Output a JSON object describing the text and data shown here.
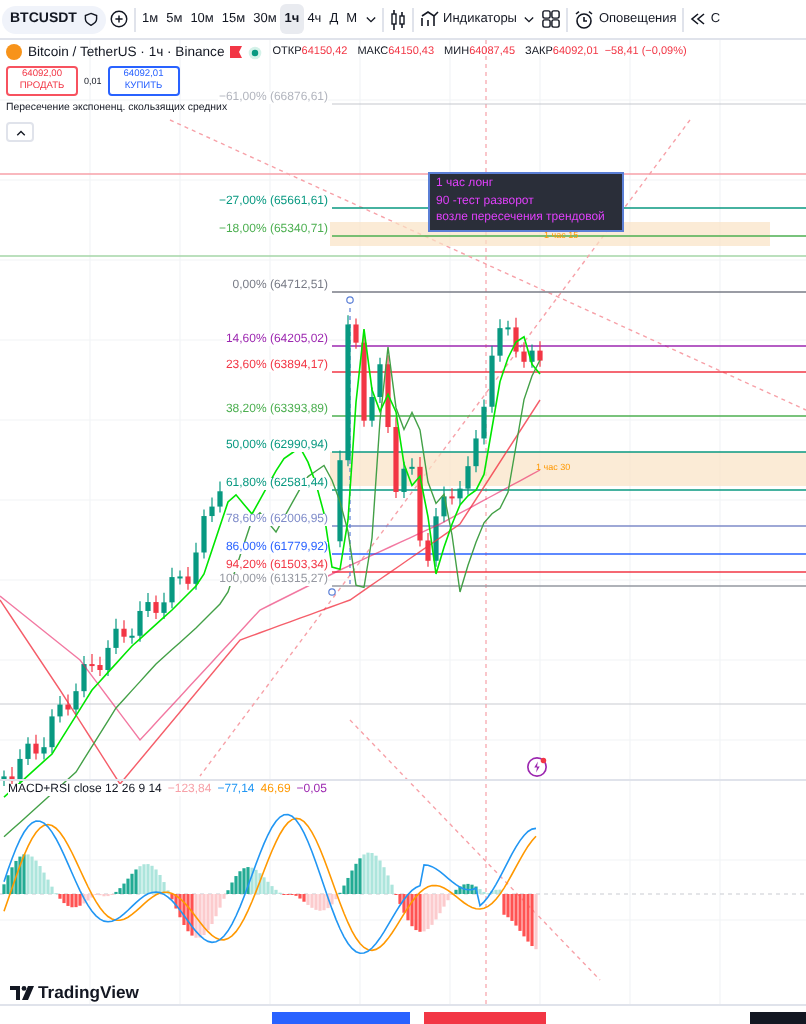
{
  "toolbar": {
    "symbol": "BTCUSDT",
    "intervals": [
      {
        "label": "1м",
        "selected": false
      },
      {
        "label": "5м",
        "selected": false
      },
      {
        "label": "10м",
        "selected": false
      },
      {
        "label": "15м",
        "selected": false
      },
      {
        "label": "30м",
        "selected": false
      },
      {
        "label": "1ч",
        "selected": true
      },
      {
        "label": "4ч",
        "selected": false
      },
      {
        "label": "Д",
        "selected": false
      },
      {
        "label": "М",
        "selected": false
      }
    ],
    "indicators_button": "Индикаторы",
    "alerts_button": "Оповещения",
    "replay_button": "С"
  },
  "legend": {
    "title": "Bitcoin / TetherUS · 1ч · Binance",
    "ohlc": [
      {
        "key": "ОТКР",
        "value": "64150,42"
      },
      {
        "key": "МАКС",
        "value": "64150,43"
      },
      {
        "key": "МИН",
        "value": "64087,45"
      },
      {
        "key": "ЗАКР",
        "value": "64092,01"
      }
    ],
    "change": "−58,41 (−0,09%)"
  },
  "trade": {
    "sell_price": "64092,00",
    "sell_label": "ПРОДАТЬ",
    "spread": "0,01",
    "buy_price": "64092,01",
    "buy_label": "КУПИТЬ"
  },
  "indicator_legend": "Пересечение экспоненц. скользящих средних",
  "fib_levels": [
    {
      "label": "−61,00% (66876,61)",
      "color": "#b2b5be"
    },
    {
      "label": "−27,00% (65661,61)",
      "color": "#089981"
    },
    {
      "label": "−18,00% (65340,71)",
      "color": "#4caf50"
    },
    {
      "label": "0,00% (64712,51)",
      "color": "#787b86"
    },
    {
      "label": "14,60% (64205,02)",
      "color": "#9c27b0"
    },
    {
      "label": "23,60% (63894,17)",
      "color": "#f23645"
    },
    {
      "label": "38,20% (63393,89)",
      "color": "#4caf50"
    },
    {
      "label": "50,00% (62990,94)",
      "color": "#089981"
    },
    {
      "label": "61,80% (62581,44)",
      "color": "#089981"
    },
    {
      "label": "78,60% (62006,95)",
      "color": "#7e8bc9"
    },
    {
      "label": "86,00% (61779,92)",
      "color": "#2962ff"
    },
    {
      "label": "94,20% (61503,34)",
      "color": "#f23645"
    },
    {
      "label": "100,00% (61315,27)",
      "color": "#9598a1"
    }
  ],
  "zones": [
    {
      "label": "1 час 15"
    },
    {
      "label": "1 час 30"
    }
  ],
  "note": {
    "lines": [
      "1 час лонг",
      "90 -тест разворот",
      "возле пересечения трендовой"
    ]
  },
  "macd": {
    "title": "MACD+RSI close 12 26 9 14",
    "values": [
      {
        "text": "−123,84",
        "color": "#f7a1a8"
      },
      {
        "text": "−77,14",
        "color": "#2196f3"
      },
      {
        "text": "46,69",
        "color": "#ff9800"
      },
      {
        "text": "−0,05",
        "color": "#9c27b0"
      }
    ]
  },
  "logo": "TradingView"
}
